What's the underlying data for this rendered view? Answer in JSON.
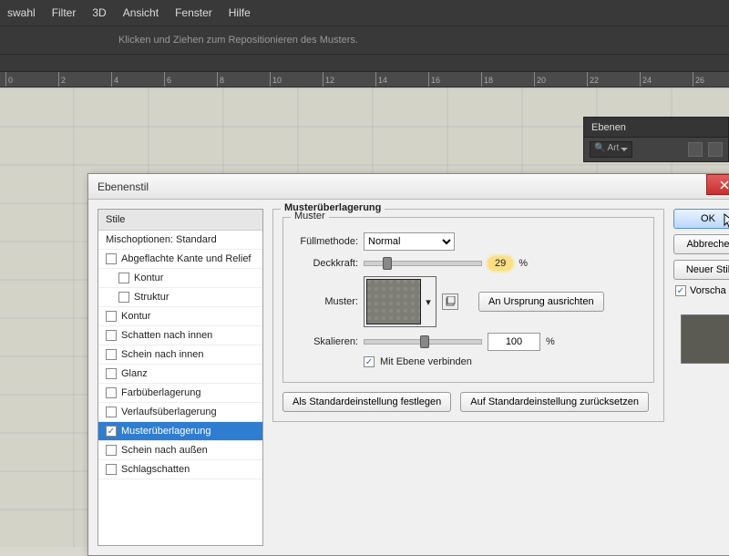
{
  "menu": {
    "items": [
      "swahl",
      "Filter",
      "3D",
      "Ansicht",
      "Fenster",
      "Hilfe"
    ]
  },
  "infobar": {
    "text": "Klicken und Ziehen zum Repositionieren des Musters."
  },
  "ruler": {
    "marks": [
      0,
      2,
      4,
      6,
      8,
      10,
      12,
      14,
      16,
      18,
      20,
      22,
      24,
      26
    ]
  },
  "layers": {
    "title": "Ebenen",
    "kindLabel": "Art"
  },
  "dialog": {
    "title": "Ebenenstil",
    "styles": {
      "header": "Stile",
      "blendOptions": "Mischoptionen: Standard",
      "items": [
        {
          "label": "Abgeflachte Kante und Relief",
          "checked": false,
          "sub": false
        },
        {
          "label": "Kontur",
          "checked": false,
          "sub": true
        },
        {
          "label": "Struktur",
          "checked": false,
          "sub": true
        },
        {
          "label": "Kontur",
          "checked": false,
          "sub": false
        },
        {
          "label": "Schatten nach innen",
          "checked": false,
          "sub": false
        },
        {
          "label": "Schein nach innen",
          "checked": false,
          "sub": false
        },
        {
          "label": "Glanz",
          "checked": false,
          "sub": false
        },
        {
          "label": "Farbüberlagerung",
          "checked": false,
          "sub": false
        },
        {
          "label": "Verlaufsüberlagerung",
          "checked": false,
          "sub": false
        },
        {
          "label": "Musterüberlagerung",
          "checked": true,
          "sub": false,
          "active": true
        },
        {
          "label": "Schein nach außen",
          "checked": false,
          "sub": false
        },
        {
          "label": "Schlagschatten",
          "checked": false,
          "sub": false
        }
      ]
    },
    "content": {
      "groupTitle": "Musterüberlagerung",
      "subGroupTitle": "Muster",
      "blendModeLabel": "Füllmethode:",
      "blendMode": "Normal",
      "opacityLabel": "Deckkraft:",
      "opacityValue": "29",
      "pct": "%",
      "patternLabel": "Muster:",
      "snapBtn": "An Ursprung ausrichten",
      "scaleLabel": "Skalieren:",
      "scaleValue": "100",
      "linkLabel": "Mit Ebene verbinden",
      "makeDefault": "Als Standardeinstellung festlegen",
      "resetDefault": "Auf Standardeinstellung zurücksetzen"
    },
    "buttons": {
      "ok": "OK",
      "cancel": "Abbreche",
      "newStyle": "Neuer Stil",
      "preview": "Vorscha"
    }
  }
}
